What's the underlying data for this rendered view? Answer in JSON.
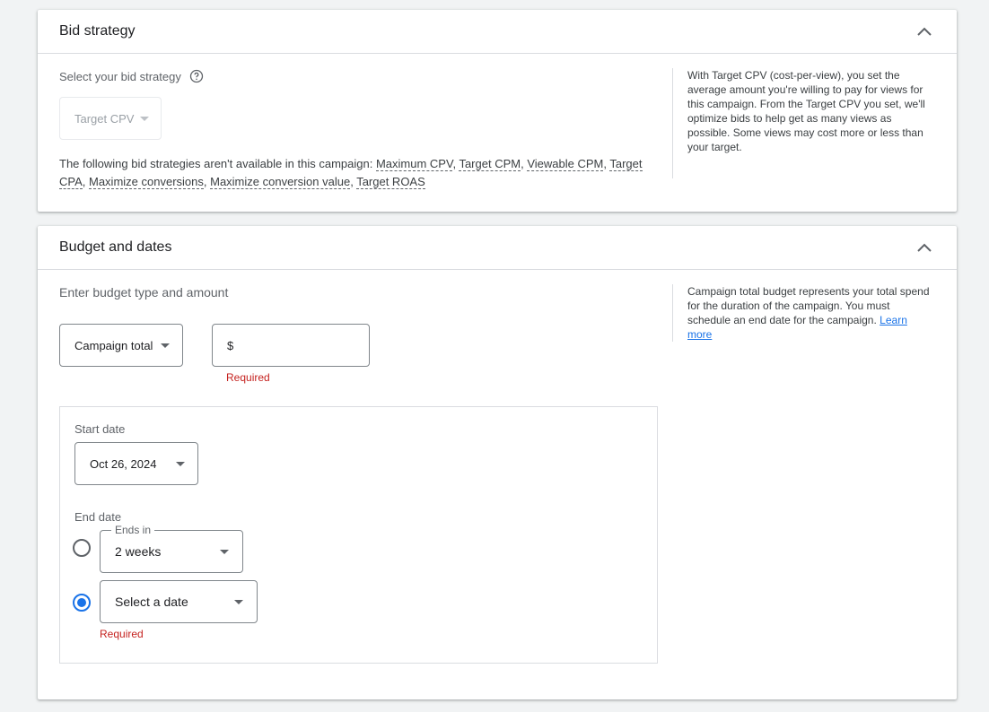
{
  "bid_strategy": {
    "title": "Bid strategy",
    "select_label": "Select your bid strategy",
    "selected": "Target CPV",
    "unavailable_prefix": "The following bid strategies aren't available in this campaign:",
    "unavailable": [
      "Maximum CPV",
      "Target CPM",
      "Viewable CPM",
      "Target CPA",
      "Maximize conversions",
      "Maximize conversion value",
      "Target ROAS"
    ],
    "side_note": "With Target CPV (cost-per-view), you set the average amount you're willing to pay for views for this campaign. From the Target CPV you set, we'll optimize bids to help get as many views as possible. Some views may cost more or less than your target."
  },
  "budget": {
    "title": "Budget and dates",
    "enter_label": "Enter budget type and amount",
    "type_selected": "Campaign total",
    "amount_prefix": "$",
    "amount_value": "",
    "amount_error": "Required",
    "side_note": "Campaign total budget represents your total spend for the duration of the campaign. You must schedule an end date for the campaign.",
    "learn_more": "Learn more",
    "start_date_label": "Start date",
    "start_date": "Oct 26, 2024",
    "end_date_label": "End date",
    "ends_in_label": "Ends in",
    "ends_in_value": "2 weeks",
    "select_date_value": "Select a date",
    "end_date_error": "Required",
    "selected_end_option": "select-date"
  },
  "colors": {
    "accent": "#1a73e8",
    "error": "#c5221f",
    "background": "#f1f3f4"
  }
}
